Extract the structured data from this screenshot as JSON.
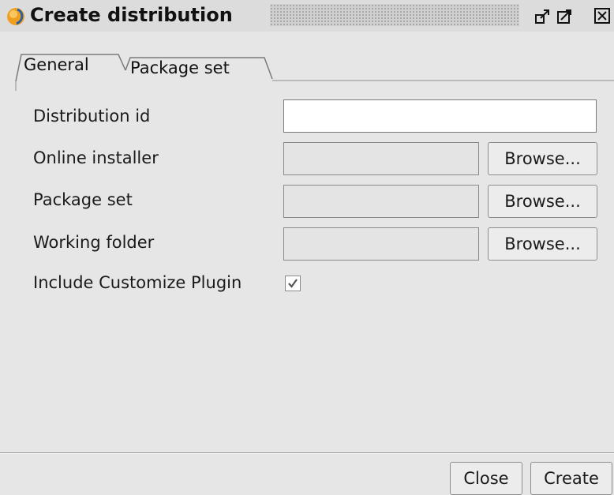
{
  "window": {
    "title": "Create distribution",
    "icon": "app-swirl-icon"
  },
  "tabs": [
    {
      "label": "General",
      "selected": true
    },
    {
      "label": "Package set",
      "selected": false
    }
  ],
  "form": {
    "distribution_id": {
      "label": "Distribution id",
      "value": ""
    },
    "online_installer": {
      "label": "Online installer",
      "value": "",
      "browse_label": "Browse..."
    },
    "package_set": {
      "label": "Package set",
      "value": "",
      "browse_label": "Browse..."
    },
    "working_folder": {
      "label": "Working folder",
      "value": "",
      "browse_label": "Browse..."
    },
    "include_customize_plugin": {
      "label": "Include Customize Plugin",
      "checked": true
    }
  },
  "footer": {
    "close_label": "Close",
    "create_label": "Create"
  },
  "colors": {
    "background": "#e6e6e6",
    "app_icon_orange": "#f0a020",
    "app_icon_blue": "#2a5fa8"
  }
}
